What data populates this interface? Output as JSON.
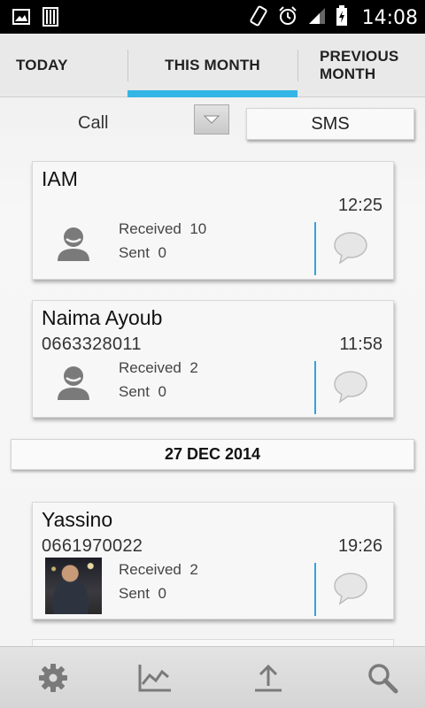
{
  "status_bar": {
    "time": "14:08",
    "icons": [
      "image-icon",
      "barcode-icon",
      "rotate-icon",
      "alarm-icon",
      "signal-icon",
      "battery-charging-icon"
    ]
  },
  "tabs": [
    {
      "label": "TODAY",
      "selected": false
    },
    {
      "label": "THIS MONTH",
      "selected": true
    },
    {
      "label": "PREVIOUS MONTH",
      "selected": false
    }
  ],
  "filter": {
    "call_label": "Call",
    "sms_label": "SMS"
  },
  "colors": {
    "accent": "#33b5e5",
    "divider": "#33a3d9"
  },
  "cards": [
    {
      "name": "IAM",
      "number": "",
      "time": "12:25",
      "received_label": "Received",
      "received_count": "10",
      "sent_label": "Sent",
      "sent_count": "0",
      "avatar": "default-avatar-icon"
    },
    {
      "name": "Naima Ayoub",
      "number": "0663328011",
      "time": "11:58",
      "received_label": "Received",
      "received_count": "2",
      "sent_label": "Sent",
      "sent_count": "0",
      "avatar": "default-avatar-icon"
    },
    {
      "name": "Yassino",
      "number": "0661970022",
      "time": "19:26",
      "received_label": "Received",
      "received_count": "2",
      "sent_label": "Sent",
      "sent_count": "0",
      "avatar": "contact-photo"
    }
  ],
  "date_header": "27 DEC 2014",
  "bottom_bar": {
    "icons": [
      "settings-gear-icon",
      "chart-icon",
      "upload-icon",
      "search-icon"
    ]
  }
}
